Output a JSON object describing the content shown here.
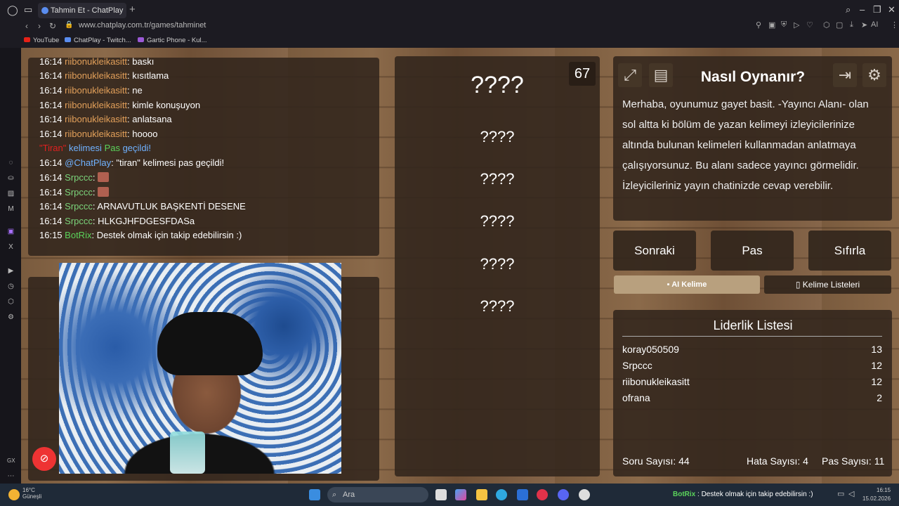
{
  "browser": {
    "tab_title": "Tahmin Et - ChatPlay",
    "url": "www.chatplay.com.tr/games/tahminet",
    "new_tab": "+",
    "ai_label": "AI",
    "bookmarks": [
      {
        "label": "YouTube",
        "color": "#e62117"
      },
      {
        "label": "ChatPlay - Twitch...",
        "color": "#5a8df0"
      },
      {
        "label": "Gartic Phone - Kul...",
        "color": "#9b59d6"
      }
    ],
    "sidebar_bottom": "GX"
  },
  "chat": {
    "messages": [
      {
        "time": "16:14",
        "user": "riibonukleikasitt",
        "text": ": baskı",
        "user_color": "orange"
      },
      {
        "time": "16:14",
        "user": "riibonukleikasitt",
        "text": ": kısıtlama",
        "user_color": "orange"
      },
      {
        "time": "16:14",
        "user": "riibonukleikasitt",
        "text": ": ne",
        "user_color": "orange"
      },
      {
        "time": "16:14",
        "user": "riibonukleikasitt",
        "text": ": kimle konuşuyon",
        "user_color": "orange"
      },
      {
        "time": "16:14",
        "user": "riibonukleikasitt",
        "text": ": anlatsana",
        "user_color": "orange"
      },
      {
        "time": "16:14",
        "user": "riibonukleikasitt",
        "text": ": hoooo",
        "user_color": "orange"
      }
    ],
    "system_message": {
      "word": "\"Tiran\"",
      "mid1": " kelimesi ",
      "mid2": "Pas",
      "tail": " geçildi!"
    },
    "messages2": [
      {
        "time": "16:14",
        "user": "@ChatPlay",
        "text": ": \"tiran\" kelimesi pas geçildi!",
        "user_color": "blue"
      },
      {
        "time": "16:14",
        "user": "Srpccc",
        "text": ":",
        "user_color": "green",
        "emote": true
      },
      {
        "time": "16:14",
        "user": "Srpccc",
        "text": ":",
        "user_color": "green",
        "emote": true
      },
      {
        "time": "16:14",
        "user": "Srpccc",
        "text": ": ARNAVUTLUK BAŞKENTİ DESENE",
        "user_color": "green"
      },
      {
        "time": "16:14",
        "user": "Srpccc",
        "text": ": HLKGJHFDGESFDASa",
        "user_color": "green"
      },
      {
        "time": "16:15",
        "user": "BotRix",
        "text": ": Destek olmak için takip edebilirsin :)",
        "user_color": "bright"
      }
    ]
  },
  "game": {
    "timer": "67",
    "words": [
      "????",
      "????",
      "????",
      "????",
      "????",
      "????"
    ]
  },
  "howto": {
    "title": "Nasıl Oynanır?",
    "text": "Merhaba, oyunumuz gayet basit. -Yayıncı Alanı- olan sol altta ki bölüm de yazan kelimeyi izleyicilerinize altında bulunan kelimeleri kullanmadan anlatmaya çalışıyorsunuz. Bu alanı sadece yayıncı görmelidir. İzleyicileriniz yayın chatinizde cevap verebilir."
  },
  "controls": {
    "next": "Sonraki",
    "pass": "Pas",
    "reset": "Sıfırla",
    "ai_word": "AI Kelime",
    "word_lists": "Kelime Listeleri"
  },
  "leaderboard": {
    "title": "Liderlik Listesi",
    "rows": [
      {
        "name": "koray050509",
        "score": "13"
      },
      {
        "name": "Srpccc",
        "score": "12"
      },
      {
        "name": "riibonukleikasitt",
        "score": "12"
      },
      {
        "name": "ofrana",
        "score": "2"
      }
    ]
  },
  "stats": {
    "questions": "Soru Sayısı: 44",
    "errors": "Hata Sayısı: 4",
    "passes": "Pas Sayısı: 11"
  },
  "taskbar": {
    "search_placeholder": "Ara",
    "notification_user": "BotRix",
    "notification_text": " : Destek olmak için takip edebilirsin :)",
    "weather_temp": "16°C",
    "weather_desc": "Güneşli",
    "time": "16:15",
    "date": "15.02.2026"
  }
}
